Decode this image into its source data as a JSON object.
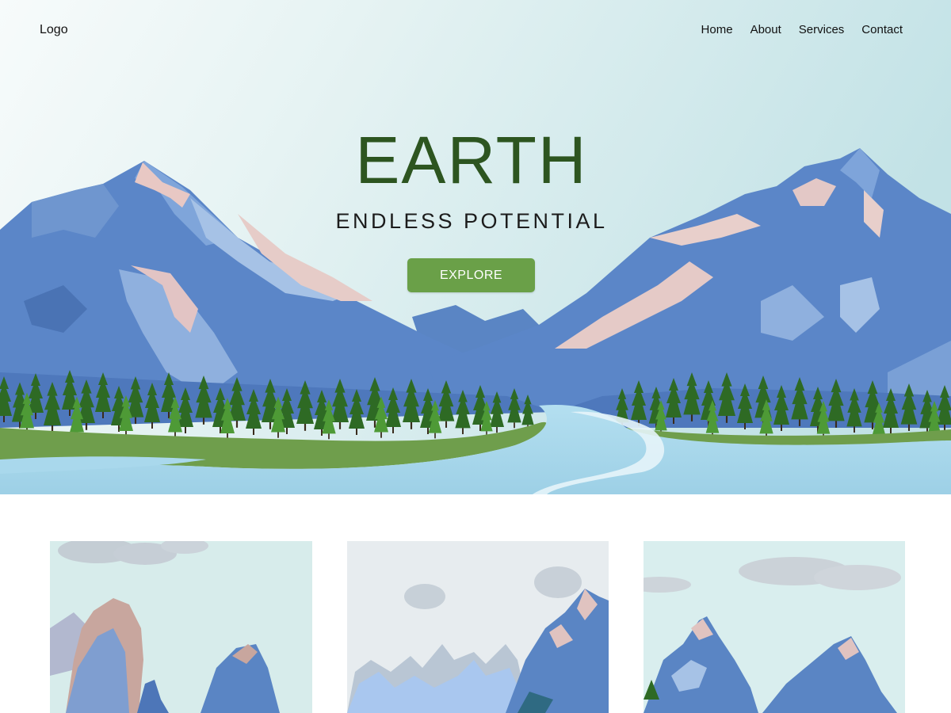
{
  "header": {
    "logo": "Logo",
    "nav": [
      "Home",
      "About",
      "Services",
      "Contact"
    ]
  },
  "hero": {
    "title": "EARTH",
    "subtitle": "ENDLESS POTENTIAL",
    "cta": "EXPLORE"
  },
  "colors": {
    "title_green": "#2d5520",
    "button_green": "#6aa048",
    "sky_teal": "#c9e6e8",
    "mountain_blue": "#5b86c8",
    "water_blue": "#a6d6ea"
  }
}
